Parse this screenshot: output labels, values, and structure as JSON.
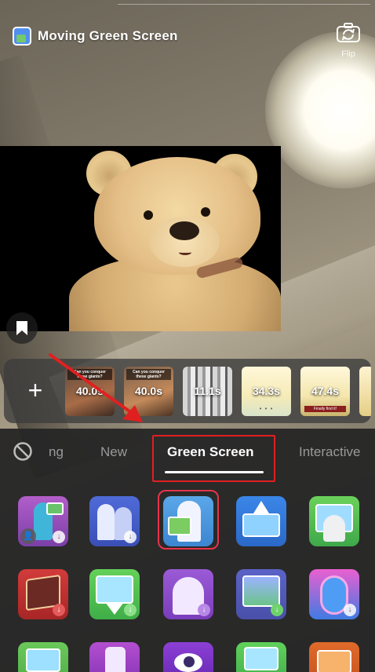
{
  "header": {
    "effect_title": "Moving Green Screen",
    "flip_label": "Flip"
  },
  "tray": {
    "add_label": "+",
    "thumbnails": [
      {
        "caption": "Can you conquer these giants?",
        "duration": "40.0s",
        "subtitle": ""
      },
      {
        "caption": "Can you conquer these giants?",
        "duration": "40.0s",
        "subtitle": ""
      },
      {
        "caption": "",
        "duration": "11.1s",
        "subtitle": ""
      },
      {
        "caption": "",
        "duration": "34.3s",
        "subtitle": ""
      },
      {
        "caption": "",
        "duration": "47.4s",
        "subtitle": "Finally find it!"
      },
      {
        "caption": "",
        "duration": "",
        "subtitle": ""
      }
    ]
  },
  "tabs": {
    "partial": "ng",
    "new": "New",
    "green_screen": "Green Screen",
    "interactive": "Interactive"
  },
  "colors": {
    "panel_bg": "#262626",
    "highlight_red": "#e02020",
    "selected_pink": "#e8334a"
  }
}
